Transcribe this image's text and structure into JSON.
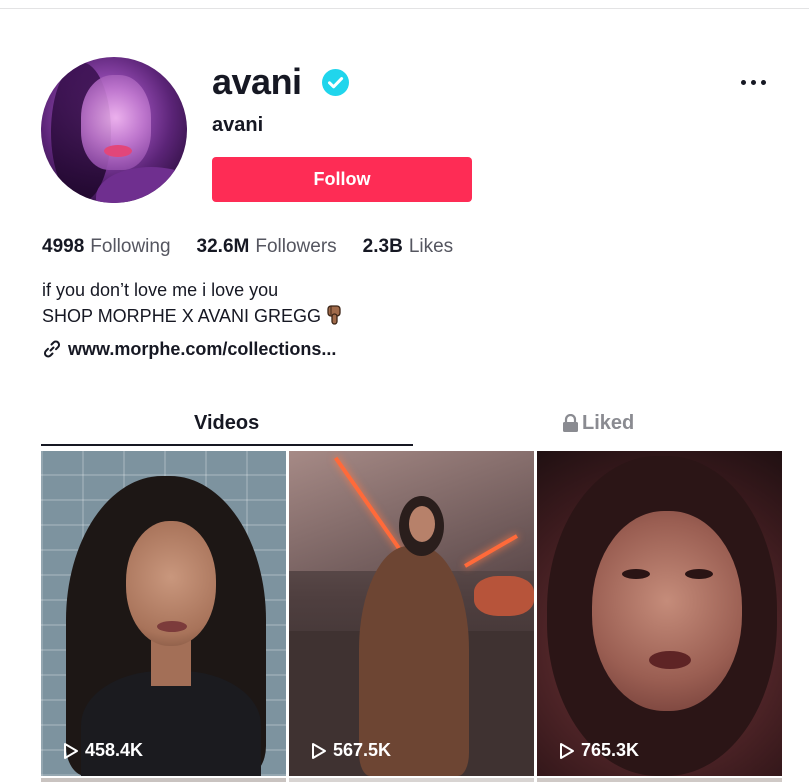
{
  "profile": {
    "username": "avani",
    "nickname": "avani",
    "follow_label": "Follow",
    "verified": true
  },
  "stats": {
    "following": {
      "num": "4998",
      "label": "Following"
    },
    "followers": {
      "num": "32.6M",
      "label": "Followers"
    },
    "likes": {
      "num": "2.3B",
      "label": "Likes"
    }
  },
  "bio": {
    "line1": "if you don’t love me i love you",
    "line2": "SHOP MORPHE X AVANI GREGG",
    "link": "www.morphe.com/collections..."
  },
  "tabs": {
    "videos": "Videos",
    "liked": "Liked"
  },
  "videos": [
    {
      "views": "458.4K"
    },
    {
      "views": "567.5K"
    },
    {
      "views": "765.3K"
    }
  ],
  "colors": {
    "follow_button": "#fe2c55",
    "verified_badge": "#20d5ec",
    "text_primary": "#161823",
    "text_secondary": "#8a8b91"
  },
  "icons": [
    "verified-check-icon",
    "more-dots-icon",
    "link-icon",
    "pointing-down-emoji-icon",
    "lock-icon",
    "play-icon"
  ]
}
